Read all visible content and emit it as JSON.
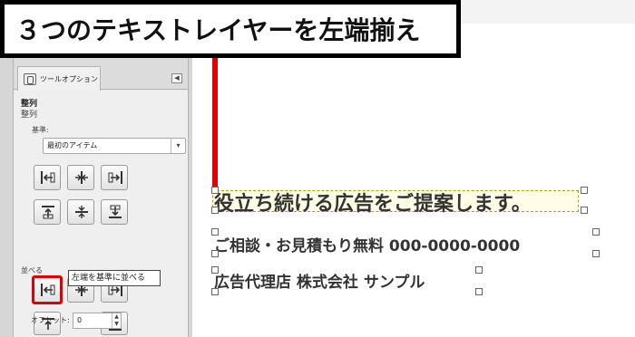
{
  "banner": {
    "title": "３つのテキストレイヤーを左端揃え"
  },
  "dock": {
    "tab_label": "ツールオプション",
    "tab_menu_glyph": "◀",
    "section_bold": "整列",
    "section_sub": "整列",
    "relative_to_label": "基準:",
    "relative_to_value": "最初のアイテム",
    "distribute_label": "並べる",
    "offset_label": "オフセット:",
    "offset_value": "0"
  },
  "tooltip": {
    "text": "左端を基準に並べる"
  },
  "canvas": {
    "line1": "役立ち続ける広告をご提案します。",
    "line2": "ご相談・お見積もり無料  000-0000-0000",
    "line3": "広告代理店 株式会社 サンプル"
  },
  "colors": {
    "highlight": "#e30000",
    "text": "#333333"
  }
}
